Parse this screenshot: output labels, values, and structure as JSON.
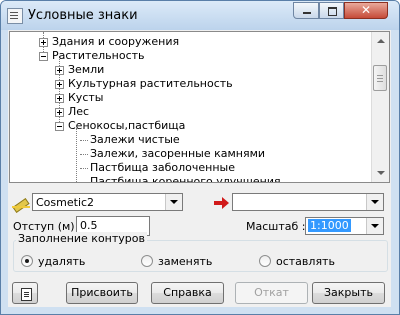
{
  "window": {
    "title": "Условные знаки"
  },
  "tree": {
    "items": [
      {
        "label": "Здания и сооружения",
        "state": "collapsed"
      },
      {
        "label": "Растительность",
        "state": "expanded"
      },
      {
        "label": "Земли",
        "state": "collapsed"
      },
      {
        "label": "Культурная растительность",
        "state": "collapsed"
      },
      {
        "label": "Кусты",
        "state": "collapsed"
      },
      {
        "label": "Лес",
        "state": "collapsed"
      },
      {
        "label": "Сенокосы,пастбища",
        "state": "expanded"
      },
      {
        "label": "Залежи чистые",
        "state": "leaf"
      },
      {
        "label": "Залежи, засоренные камнями",
        "state": "leaf"
      },
      {
        "label": "Пастбища заболоченные",
        "state": "leaf"
      },
      {
        "label": "Пастбища коренного улучшения",
        "state": "leaf"
      }
    ]
  },
  "style_combo": {
    "value": "Cosmetic2"
  },
  "target_combo": {
    "value": ""
  },
  "offset": {
    "label": "Отступ (м)",
    "value": "0.5"
  },
  "scale": {
    "label": "Масштаб :",
    "value": "1:1000"
  },
  "fill_group": {
    "title": "Заполнение контуров",
    "options": [
      {
        "label": "удалять",
        "selected": true
      },
      {
        "label": "заменять",
        "selected": false
      },
      {
        "label": "оставлять",
        "selected": false
      }
    ]
  },
  "buttons": {
    "assign": "Присвоить",
    "help": "Справка",
    "undo": "Откат",
    "close": "Закрыть"
  },
  "icons": [
    "app-icon",
    "pencil-icon",
    "red-arrow-icon",
    "document-icon",
    "minimize-icon",
    "maximize-icon",
    "close-icon"
  ]
}
